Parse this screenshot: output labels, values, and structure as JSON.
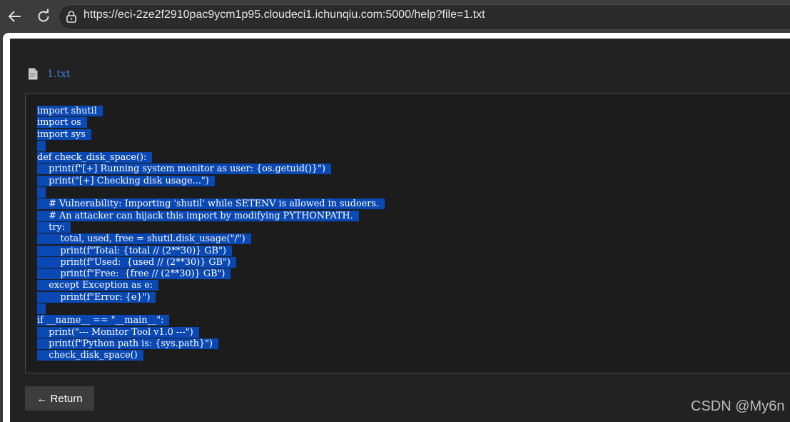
{
  "browser": {
    "url": "https://eci-2ze2f2910pac9ycm1p95.cloudeci1.ichunqiu.com:5000/help?file=1.txt",
    "icons": [
      "back-arrow-icon",
      "reload-icon",
      "lock-icon"
    ]
  },
  "file": {
    "name": "1.txt",
    "icon": "document-icon"
  },
  "code_lines": [
    "import shutil",
    "import os",
    "import sys",
    "",
    "def check_disk_space():",
    "    print(f\"[+] Running system monitor as user: {os.getuid()}\")",
    "    print(\"[+] Checking disk usage...\")",
    "",
    "    # Vulnerability: Importing 'shutil' while SETENV is allowed in sudoers.",
    "    # An attacker can hijack this import by modifying PYTHONPATH.",
    "    try:",
    "        total, used, free = shutil.disk_usage(\"/\")",
    "        print(f\"Total: {total // (2**30)} GB\")",
    "        print(f\"Used:  {used // (2**30)} GB\")",
    "        print(f\"Free:  {free // (2**30)} GB\")",
    "    except Exception as e:",
    "        print(f\"Error: {e}\")",
    "",
    "if __name__ == \"__main__\":",
    "    print(\"--- Monitor Tool v1.0 ---\")",
    "    print(f\"Python path is: {sys.path}\")",
    "    check_disk_space()"
  ],
  "return_label": "← Return",
  "watermark": "CSDN @My6n",
  "colors": {
    "selection": "#0a48b4",
    "link": "#3f7fd6",
    "page_background": "#222222"
  }
}
